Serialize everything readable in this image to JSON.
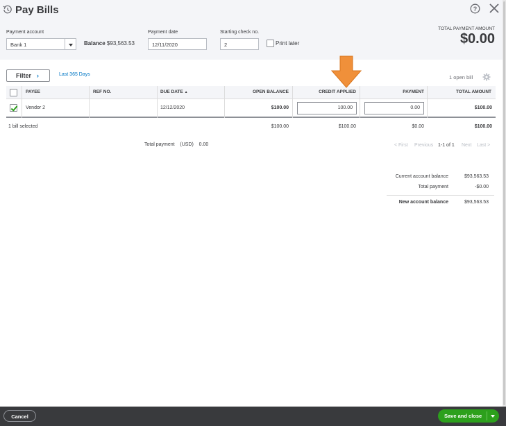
{
  "window": {
    "title": "Pay Bills"
  },
  "header": {
    "payment_account_label": "Payment account",
    "payment_account_value": "Bank 1",
    "balance_label": "Balance",
    "balance_value": "$93,563.53",
    "payment_date_label": "Payment date",
    "payment_date_value": "12/11/2020",
    "check_no_label": "Starting check no.",
    "check_no_value": "2",
    "print_later_label": "Print later",
    "print_later_checked": false,
    "total_payment_amount_label": "TOTAL PAYMENT AMOUNT",
    "total_payment_amount_value": "$0.00"
  },
  "toolbar": {
    "filter_label": "Filter",
    "date_filter": "Last 365 Days",
    "open_bill_count": "1 open bill"
  },
  "table": {
    "columns": [
      "PAYEE",
      "REF NO.",
      "DUE DATE",
      "OPEN BALANCE",
      "CREDIT APPLIED",
      "PAYMENT",
      "TOTAL AMOUNT"
    ],
    "sort_indicator": "▲",
    "rows": [
      {
        "selected": true,
        "payee": "Vendor 2",
        "ref_no": "",
        "due_date": "12/12/2020",
        "open_balance": "$100.00",
        "credit_applied": "100.00",
        "payment": "0.00",
        "total_amount": "$100.00"
      }
    ],
    "summary": {
      "selected_text": "1 bill selected",
      "open_balance": "$100.00",
      "credit_applied": "$100.00",
      "payment": "$0.00",
      "total_amount": "$100.00"
    }
  },
  "total_payment": {
    "label": "Total payment",
    "currency": "(USD)",
    "value": "0.00"
  },
  "pager": {
    "first": "< First",
    "previous": "Previous",
    "range": "1-1 of 1",
    "next": "Next",
    "last": "Last >"
  },
  "account_balance": {
    "current_label": "Current account balance",
    "current_value": "$93,563.53",
    "total_payment_label": "Total payment",
    "total_payment_value": "-$0.00",
    "new_label": "New account balance",
    "new_value": "$93,563.53"
  },
  "footer": {
    "cancel_label": "Cancel",
    "save_label": "Save and close"
  },
  "colors": {
    "accent_green": "#2ca01c",
    "link_blue": "#0077c5",
    "annotation_arrow": "#f0903a",
    "footer_bg": "#393a3d"
  },
  "icons": [
    "history-icon",
    "help-icon",
    "close-icon",
    "chevron-down-icon",
    "chevron-right-icon",
    "gear-icon",
    "checkmark-icon",
    "sort-up-icon",
    "arrow-annotation"
  ]
}
